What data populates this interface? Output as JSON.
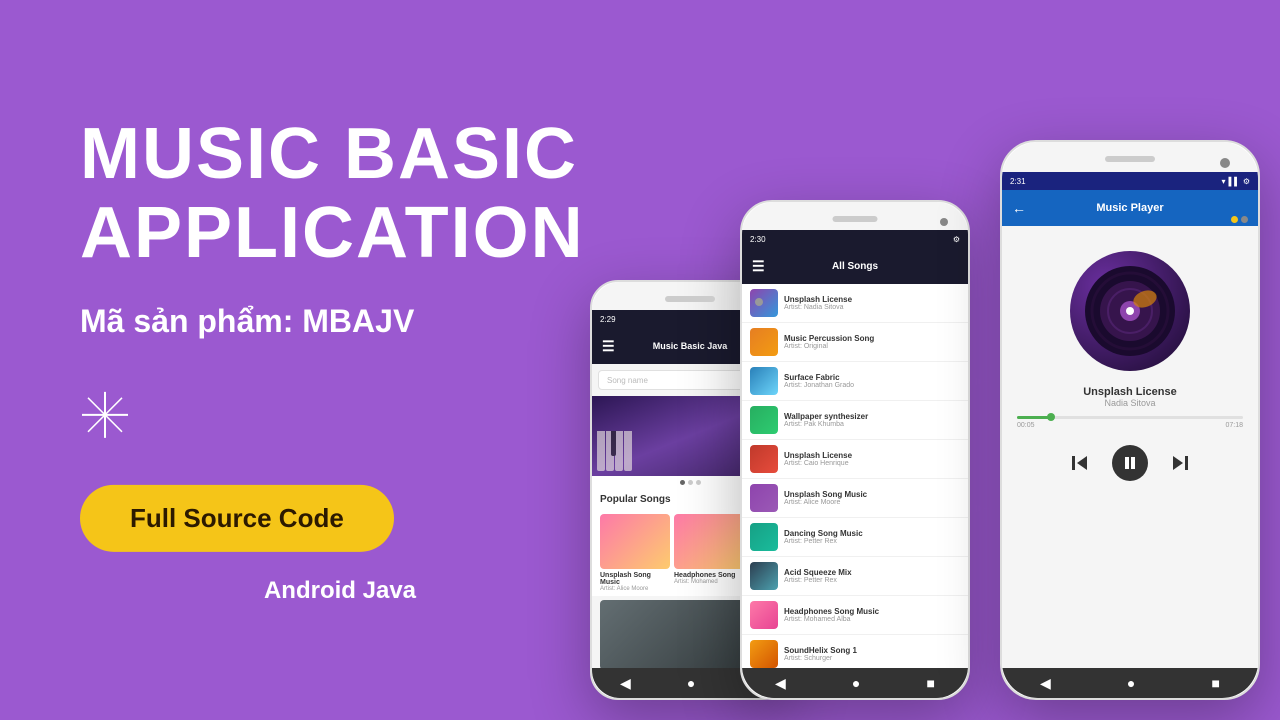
{
  "background_color": "#9B59D0",
  "left": {
    "title_line1": "MUSIC BASIC",
    "title_line2": "APPLICATION",
    "product_code_label": "Mã sản phẩm: MBAJV",
    "cta_button_label": "Full Source Code",
    "subtitle": "Android Java"
  },
  "phone1": {
    "status_time": "2:29",
    "toolbar_title": "Music Basic Java",
    "search_placeholder": "Song name",
    "banner_alt": "Music keyboard image",
    "section_popular": "Popular Songs",
    "songs": [
      {
        "title": "Unsplash Song Music",
        "artist": "Artist: Alice Moore"
      },
      {
        "title": "Headphones Song",
        "artist": "Artist: Mohamed"
      }
    ],
    "nav": [
      "◀",
      "●",
      "■"
    ]
  },
  "phone2": {
    "status_time": "2:30",
    "toolbar_title": "All Songs",
    "songs": [
      {
        "title": "Unsplash License",
        "artist": "Artist: Nadia Sitova"
      },
      {
        "title": "Music Percussion Song",
        "artist": "Artist: Original"
      },
      {
        "title": "Surface Fabric",
        "artist": "Artist: Jonathan Grado"
      },
      {
        "title": "Wallpaper synthesizer",
        "artist": "Artist: Pak Khumba"
      },
      {
        "title": "Unsplash License",
        "artist": "Artist: Caio Henrique"
      },
      {
        "title": "Unsplash Song Music",
        "artist": "Artist: Alice Moore"
      },
      {
        "title": "Dancing Song Music",
        "artist": "Artist: Petter Rex"
      },
      {
        "title": "Acid Squeeze Mix",
        "artist": "Artist: Petter Rex"
      },
      {
        "title": "Headphones Song Music",
        "artist": "Artist: Mohamed Alba"
      },
      {
        "title": "SoundHelix Song 1",
        "artist": "Artist: Schurger"
      }
    ],
    "nav": [
      "◀",
      "●",
      "■"
    ]
  },
  "phone3": {
    "status_time": "2:31",
    "toolbar_title": "Music Player",
    "now_playing_title": "Unsplash License",
    "now_playing_artist": "Nadia Sitova",
    "progress_current": "00:05",
    "progress_total": "07:18",
    "nav": [
      "◀",
      "●",
      "■"
    ]
  }
}
